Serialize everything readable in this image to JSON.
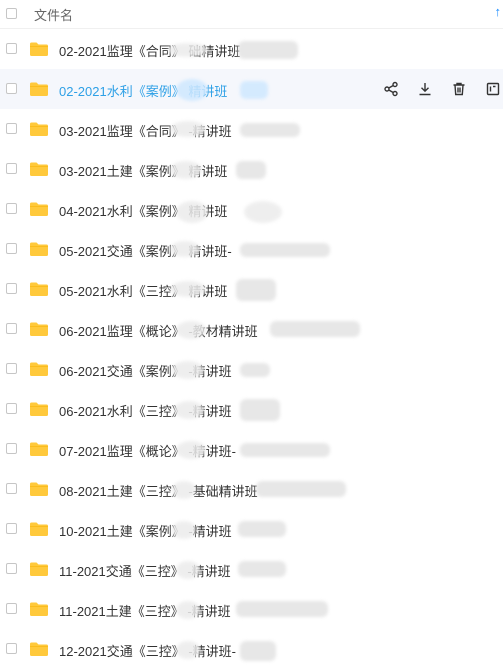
{
  "header": {
    "column_label": "文件名",
    "sort_icon": "arrow-up-icon"
  },
  "files": [
    {
      "name": "02-2021监理《合同》 础精讲班"
    },
    {
      "name": "02-2021水利《案例》 精讲班"
    },
    {
      "name": "03-2021监理《合同》 -精讲班"
    },
    {
      "name": "03-2021土建《案例》 精讲班"
    },
    {
      "name": "04-2021水利《案例》 精讲班"
    },
    {
      "name": "05-2021交通《案例》 精讲班-"
    },
    {
      "name": "05-2021水利《三控》 精讲班"
    },
    {
      "name": "06-2021监理《概论》 -教材精讲班"
    },
    {
      "name": "06-2021交通《案例》 -精讲班"
    },
    {
      "name": "06-2021水利《三控》 -精讲班"
    },
    {
      "name": "07-2021监理《概论》 -精讲班-"
    },
    {
      "name": "08-2021土建《三控》 -基础精讲班"
    },
    {
      "name": "10-2021土建《案例》 -精讲班"
    },
    {
      "name": "11-2021交通《三控》 -精讲班"
    },
    {
      "name": "11-2021土建《三控》 -精讲班"
    },
    {
      "name": "12-2021交通《三控》 -精讲班-"
    }
  ],
  "row_actions": [
    "share-icon",
    "download-icon",
    "delete-icon",
    "more-icon"
  ],
  "colors": {
    "accent": "#1a8cff",
    "folder": "#ffc93c",
    "hover_bg": "#f5f7fc"
  }
}
